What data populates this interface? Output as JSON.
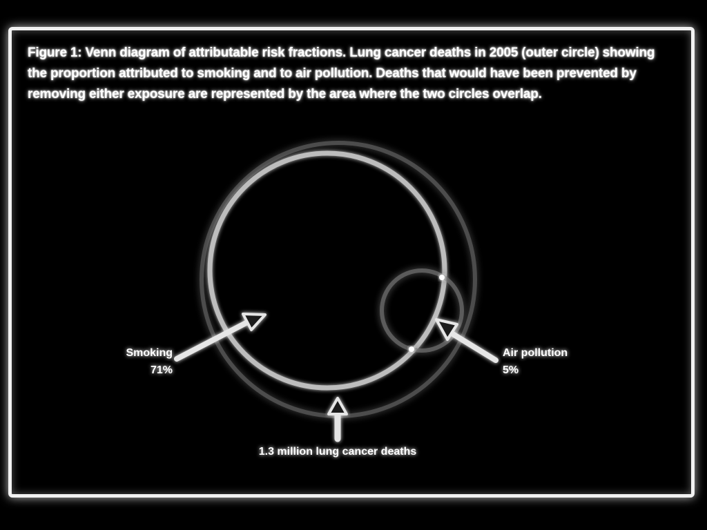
{
  "figure": {
    "caption": "Figure 1: Venn diagram of attributable risk fractions. Lung cancer deaths in 2005 (outer circle) showing the proportion attributed to smoking and to air pollution. Deaths that would have been prevented by removing either exposure are represented by the area where the two circles overlap.",
    "labels": {
      "smoking": "Smoking",
      "smoking_value": "71%",
      "air_pollution": "Air pollution",
      "air_pollution_value": "5%",
      "total": "1.3 million lung cancer deaths"
    }
  },
  "colors": {
    "background": "#000000",
    "stroke": "#ffffff",
    "frame": "#f2f2f2"
  }
}
